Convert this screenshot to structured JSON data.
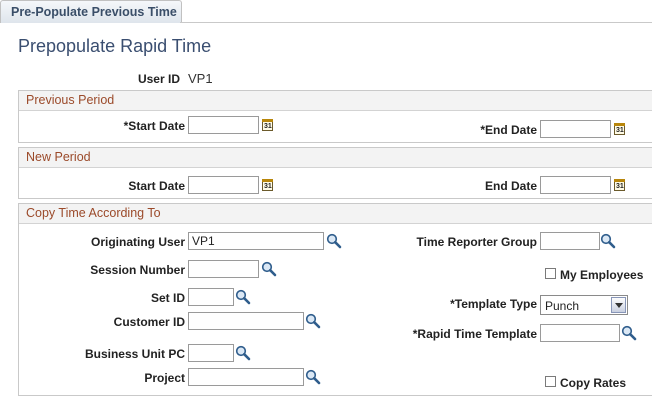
{
  "tab": {
    "label": "Pre-Populate Previous Time"
  },
  "page": {
    "title": "Prepopulate Rapid Time"
  },
  "user": {
    "label": "User ID",
    "value": "VP1"
  },
  "previous_period": {
    "header": "Previous Period",
    "start_label": "*Start Date",
    "start_value": "",
    "end_label": "*End Date",
    "end_value": ""
  },
  "new_period": {
    "header": "New Period",
    "start_label": "Start Date",
    "start_value": "",
    "end_label": "End Date",
    "end_value": ""
  },
  "copy": {
    "header": "Copy Time According To",
    "originating_user_label": "Originating User",
    "originating_user_value": "VP1",
    "session_number_label": "Session Number",
    "session_number_value": "",
    "set_id_label": "Set ID",
    "set_id_value": "",
    "customer_id_label": "Customer ID",
    "customer_id_value": "",
    "business_unit_label": "Business Unit PC",
    "business_unit_value": "",
    "project_label": "Project",
    "project_value": "",
    "time_reporter_group_label": "Time Reporter Group",
    "time_reporter_group_value": "",
    "my_employees_label": "My Employees",
    "my_employees_checked": false,
    "template_type_label": "*Template Type",
    "template_type_value": "Punch",
    "rapid_time_template_label": "*Rapid Time Template",
    "rapid_time_template_value": "",
    "copy_rates_label": "Copy Rates",
    "copy_rates_checked": false
  },
  "icons": {
    "calendar": "calendar-icon",
    "lookup": "magnifier-icon",
    "calendar_glyph": "31"
  }
}
